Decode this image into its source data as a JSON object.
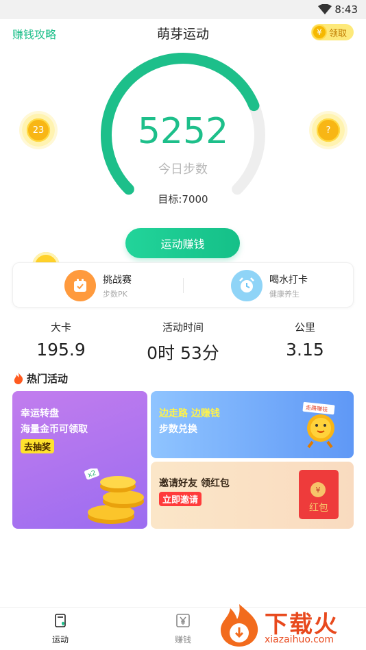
{
  "status_bar": {
    "time": "8:43"
  },
  "header": {
    "left_link": "赚钱攻略",
    "title": "萌芽运动",
    "claim": {
      "coin_symbol": "¥",
      "label": "领取"
    }
  },
  "gauge": {
    "steps": "5252",
    "steps_label": "今日步数",
    "goal_text": "目标:7000",
    "progress": 0.75,
    "accent": "#1dbf8a",
    "track": "#eeeeee"
  },
  "float_coins": {
    "left_value": "23",
    "right_value": "?"
  },
  "earn_button": {
    "label": "运动赚钱"
  },
  "features": [
    {
      "title": "挑战赛",
      "subtitle": "步数PK",
      "icon": "calendar-check-icon",
      "color": "#ff9a3d"
    },
    {
      "title": "喝水打卡",
      "subtitle": "健康养生",
      "icon": "alarm-clock-icon",
      "color": "#6cc5f5"
    }
  ],
  "stats": [
    {
      "label": "大卡",
      "value": "195.9"
    },
    {
      "label": "活动时间",
      "value": "0时 53分"
    },
    {
      "label": "公里",
      "value": "3.15"
    }
  ],
  "hot": {
    "title": "热门活动",
    "lucky": {
      "line1": "幸运转盘",
      "line2": "海量金币可领取",
      "tag": "去抽奖",
      "badge": "x2"
    },
    "walk": {
      "line1": "边走路 边赚钱",
      "line2": "步数兑换",
      "flag": "走路赚钱"
    },
    "invite": {
      "line1": "邀请好友 领红包",
      "tag": "立即邀请",
      "envelope_symbol": "¥",
      "envelope_text": "红包"
    }
  },
  "bottom_nav": [
    {
      "label": "运动",
      "icon": "sport-icon",
      "active": true
    },
    {
      "label": "赚钱",
      "icon": "yen-icon",
      "active": false
    }
  ],
  "watermark": {
    "text": "下载火",
    "url": "xiazaihuo.com"
  }
}
